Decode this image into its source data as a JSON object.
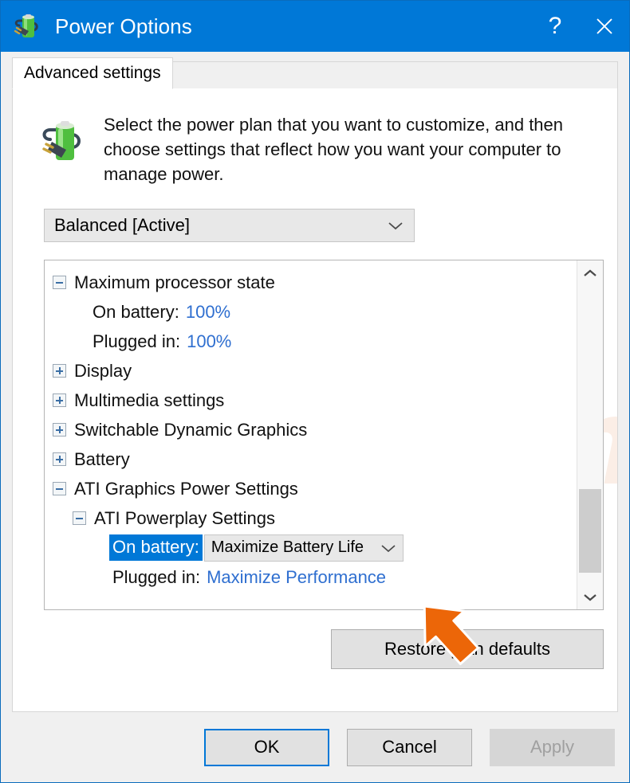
{
  "window": {
    "title": "Power Options",
    "title_icon": "battery-plug-icon",
    "help_label": "?",
    "close_label": "close-icon",
    "accent_color": "#0078d7",
    "border_color": "#0a6cbc"
  },
  "tab": {
    "label": "Advanced settings"
  },
  "description": {
    "icon": "battery-plug-icon",
    "text": "Select the power plan that you want to customize, and then choose settings that reflect how you want your computer to manage power."
  },
  "plan_combo": {
    "value": "Balanced [Active]",
    "arrow_icon": "chevron-down-icon"
  },
  "tree": {
    "rows": [
      {
        "id": "maximum-processor-state",
        "level": 0,
        "expander": "minus",
        "label": "Maximum processor state",
        "kind": "group"
      },
      {
        "id": "max-proc-on-battery",
        "level": 1,
        "expander": "none",
        "label": "On battery:",
        "value": "100%",
        "kind": "value"
      },
      {
        "id": "max-proc-plugged-in",
        "level": 1,
        "expander": "none",
        "label": "Plugged in:",
        "value": "100%",
        "kind": "value"
      },
      {
        "id": "display",
        "level": 0,
        "expander": "plus",
        "label": "Display",
        "kind": "group"
      },
      {
        "id": "multimedia-settings",
        "level": 0,
        "expander": "plus",
        "label": "Multimedia settings",
        "kind": "group"
      },
      {
        "id": "switchable-dynamic-graphics",
        "level": 0,
        "expander": "plus",
        "label": "Switchable Dynamic Graphics",
        "kind": "group"
      },
      {
        "id": "battery",
        "level": 0,
        "expander": "plus",
        "label": "Battery",
        "kind": "group"
      },
      {
        "id": "ati-graphics-power-settings",
        "level": 0,
        "expander": "minus",
        "label": "ATI Graphics Power Settings",
        "kind": "group"
      },
      {
        "id": "ati-powerplay-settings",
        "level": 1,
        "expander": "minus",
        "label": "ATI Powerplay Settings",
        "kind": "group"
      },
      {
        "id": "ati-on-battery",
        "level": 2,
        "expander": "none",
        "label": "On battery:",
        "value": "Maximize Battery Life",
        "kind": "selected-combo",
        "selected": true,
        "arrow_icon": "chevron-down-icon"
      },
      {
        "id": "ati-plugged-in",
        "level": 2,
        "expander": "none",
        "label": "Plugged in:",
        "value": "Maximize Performance",
        "kind": "value"
      }
    ],
    "scrollbar": {
      "up_icon": "chevron-up-icon",
      "down_icon": "chevron-down-icon"
    }
  },
  "buttons": {
    "restore": "Restore plan defaults",
    "ok": "OK",
    "cancel": "Cancel",
    "apply": "Apply"
  },
  "annotation": {
    "arrow": "orange-pointer-arrow",
    "color": "#ec6608"
  },
  "watermark": {
    "part1": "PC",
    "part2": "risk.com"
  }
}
